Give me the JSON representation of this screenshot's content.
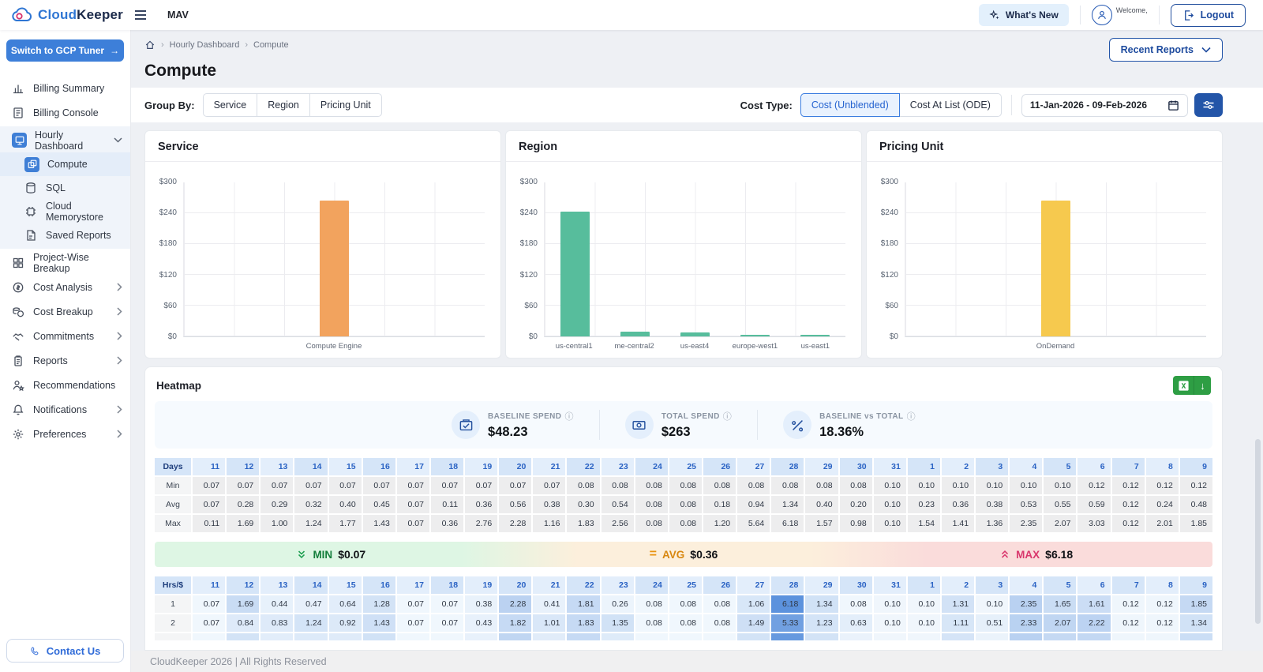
{
  "brand": {
    "cloud": "Cloud",
    "keeper": "Keeper"
  },
  "header": {
    "workspace": "MAV",
    "whats_new": "What's New",
    "welcome": "Welcome,",
    "logout": "Logout"
  },
  "sidebar": {
    "switch_button": "Switch to GCP Tuner",
    "items": [
      {
        "label": "Billing Summary",
        "icon": "bar-chart",
        "type": "plain"
      },
      {
        "label": "Billing Console",
        "icon": "console",
        "type": "plain"
      },
      {
        "label": "Hourly Dashboard",
        "icon": "dashboard",
        "type": "group-open"
      },
      {
        "label": "Compute",
        "icon": "compute",
        "type": "sub",
        "active": true
      },
      {
        "label": "SQL",
        "icon": "sql",
        "type": "sub"
      },
      {
        "label": "Cloud Memorystore",
        "icon": "memorystore",
        "type": "sub"
      },
      {
        "label": "Saved Reports",
        "icon": "saved-reports",
        "type": "sub"
      },
      {
        "label": "Project-Wise Breakup",
        "icon": "grid",
        "type": "plain"
      },
      {
        "label": "Cost Analysis",
        "icon": "cost-analysis",
        "type": "expand"
      },
      {
        "label": "Cost Breakup",
        "icon": "cost-breakup",
        "type": "expand"
      },
      {
        "label": "Commitments",
        "icon": "commitments",
        "type": "expand"
      },
      {
        "label": "Reports",
        "icon": "reports",
        "type": "expand"
      },
      {
        "label": "Recommendations",
        "icon": "recommendations",
        "type": "plain"
      },
      {
        "label": "Notifications",
        "icon": "bell",
        "type": "expand"
      },
      {
        "label": "Preferences",
        "icon": "gear",
        "type": "expand"
      }
    ],
    "contact_us": "Contact Us"
  },
  "breadcrumb": {
    "items": [
      "Hourly Dashboard",
      "Compute"
    ]
  },
  "page": {
    "title": "Compute",
    "recent_reports": "Recent Reports"
  },
  "toolbar": {
    "group_by_label": "Group By:",
    "group_by_options": [
      "Service",
      "Region",
      "Pricing Unit"
    ],
    "cost_type_label": "Cost Type:",
    "cost_type_options": [
      "Cost (Unblended)",
      "Cost At List (ODE)"
    ],
    "cost_type_selected": "Cost (Unblended)",
    "date_range": "11-Jan-2026 - 09-Feb-2026"
  },
  "chart_data": [
    {
      "type": "bar",
      "title": "Service",
      "categories": [
        "Compute Engine"
      ],
      "values": [
        263
      ],
      "bar_color": "#F2A35E",
      "ylim": [
        0,
        300
      ],
      "yticks": [
        "$300",
        "$240",
        "$180",
        "$120",
        "$60",
        "$0"
      ],
      "grid": true
    },
    {
      "type": "bar",
      "title": "Region",
      "categories": [
        "us-central1",
        "me-central2",
        "us-east4",
        "europe-west1",
        "us-east1"
      ],
      "values": [
        242,
        9,
        8,
        2.5,
        2
      ],
      "bar_color": "#57BD9C",
      "ylim": [
        0,
        300
      ],
      "yticks": [
        "$300",
        "$240",
        "$180",
        "$120",
        "$60",
        "$0"
      ],
      "grid": true
    },
    {
      "type": "bar",
      "title": "Pricing Unit",
      "categories": [
        "OnDemand"
      ],
      "values": [
        263
      ],
      "bar_color": "#F6C94E",
      "ylim": [
        0,
        300
      ],
      "yticks": [
        "$300",
        "$240",
        "$180",
        "$120",
        "$60",
        "$0"
      ],
      "grid": true
    }
  ],
  "heatmap": {
    "title": "Heatmap",
    "stats": [
      {
        "label": "BASELINE SPEND",
        "value": "$48.23",
        "icon": "stat-baseline"
      },
      {
        "label": "TOTAL SPEND",
        "value": "$263",
        "icon": "stat-total"
      },
      {
        "label": "BASELINE vs TOTAL",
        "value": "18.36%",
        "icon": "stat-compare"
      }
    ],
    "day_columns": [
      "11",
      "12",
      "13",
      "14",
      "15",
      "16",
      "17",
      "18",
      "19",
      "20",
      "21",
      "22",
      "23",
      "24",
      "25",
      "26",
      "27",
      "28",
      "29",
      "30",
      "31",
      "1",
      "2",
      "3",
      "4",
      "5",
      "6",
      "7",
      "8",
      "9"
    ],
    "summary_table": {
      "corner": "Days",
      "rows": [
        {
          "label": "Min",
          "values": [
            "0.07",
            "0.07",
            "0.07",
            "0.07",
            "0.07",
            "0.07",
            "0.07",
            "0.07",
            "0.07",
            "0.07",
            "0.07",
            "0.08",
            "0.08",
            "0.08",
            "0.08",
            "0.08",
            "0.08",
            "0.08",
            "0.08",
            "0.08",
            "0.10",
            "0.10",
            "0.10",
            "0.10",
            "0.10",
            "0.10",
            "0.12",
            "0.12",
            "0.12",
            "0.12"
          ]
        },
        {
          "label": "Avg",
          "values": [
            "0.07",
            "0.28",
            "0.29",
            "0.32",
            "0.40",
            "0.45",
            "0.07",
            "0.11",
            "0.36",
            "0.56",
            "0.38",
            "0.30",
            "0.54",
            "0.08",
            "0.08",
            "0.18",
            "0.94",
            "1.34",
            "0.40",
            "0.20",
            "0.10",
            "0.23",
            "0.36",
            "0.38",
            "0.53",
            "0.55",
            "0.59",
            "0.12",
            "0.24",
            "0.48"
          ]
        },
        {
          "label": "Max",
          "values": [
            "0.11",
            "1.69",
            "1.00",
            "1.24",
            "1.77",
            "1.43",
            "0.07",
            "0.36",
            "2.76",
            "2.28",
            "1.16",
            "1.83",
            "2.56",
            "0.08",
            "0.08",
            "1.20",
            "5.64",
            "6.18",
            "1.57",
            "0.98",
            "0.10",
            "1.54",
            "1.41",
            "1.36",
            "2.35",
            "2.07",
            "3.03",
            "0.12",
            "2.01",
            "1.85"
          ]
        }
      ]
    },
    "summary_bar": [
      {
        "kind": "min",
        "label": "MIN",
        "value": "$0.07"
      },
      {
        "kind": "avg",
        "label": "AVG",
        "value": "$0.36"
      },
      {
        "kind": "max",
        "label": "MAX",
        "value": "$6.18"
      }
    ],
    "hours_table": {
      "corner": "Hrs/$",
      "max_value": 6.18,
      "rows": [
        {
          "label": "1",
          "values": [
            "0.07",
            "1.69",
            "0.44",
            "0.47",
            "0.64",
            "1.28",
            "0.07",
            "0.07",
            "0.38",
            "2.28",
            "0.41",
            "1.81",
            "0.26",
            "0.08",
            "0.08",
            "0.08",
            "1.06",
            "6.18",
            "1.34",
            "0.08",
            "0.10",
            "0.10",
            "1.31",
            "0.10",
            "2.35",
            "1.65",
            "1.61",
            "0.12",
            "0.12",
            "1.85"
          ]
        },
        {
          "label": "2",
          "values": [
            "0.07",
            "0.84",
            "0.83",
            "1.24",
            "0.92",
            "1.43",
            "0.07",
            "0.07",
            "0.43",
            "1.82",
            "1.01",
            "1.83",
            "1.35",
            "0.08",
            "0.08",
            "0.08",
            "1.49",
            "5.33",
            "1.23",
            "0.63",
            "0.10",
            "0.10",
            "1.11",
            "0.51",
            "2.33",
            "2.07",
            "2.22",
            "0.12",
            "0.12",
            "1.34"
          ]
        }
      ]
    }
  },
  "footer": {
    "text": "CloudKeeper 2026 | All Rights Reserved"
  }
}
